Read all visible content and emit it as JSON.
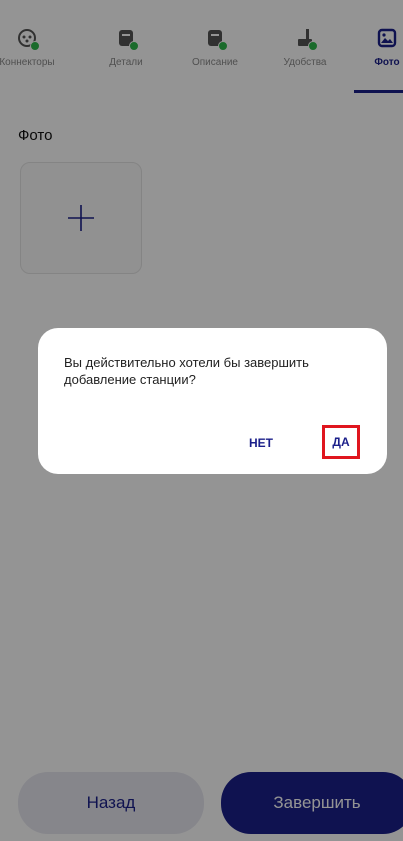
{
  "tabs": [
    {
      "label": "Коннекторы",
      "icon": "connector-icon",
      "completed": true,
      "active": false
    },
    {
      "label": "Детали",
      "icon": "details-icon",
      "completed": true,
      "active": false
    },
    {
      "label": "Описание",
      "icon": "description-icon",
      "completed": true,
      "active": false
    },
    {
      "label": "Удобства",
      "icon": "amenities-icon",
      "completed": true,
      "active": false
    },
    {
      "label": "Фото",
      "icon": "photo-icon",
      "completed": false,
      "active": true
    }
  ],
  "photo_section": {
    "title": "Фото",
    "add_icon": "plus-icon"
  },
  "buttons": {
    "back": "Назад",
    "finish": "Завершить"
  },
  "dialog": {
    "message": "Вы действительно хотели бы завершить добавление станции?",
    "no": "НЕТ",
    "yes": "ДА"
  },
  "colors": {
    "primary": "#1b1f8a",
    "success": "#2eb84b",
    "highlight": "#e0161e"
  }
}
